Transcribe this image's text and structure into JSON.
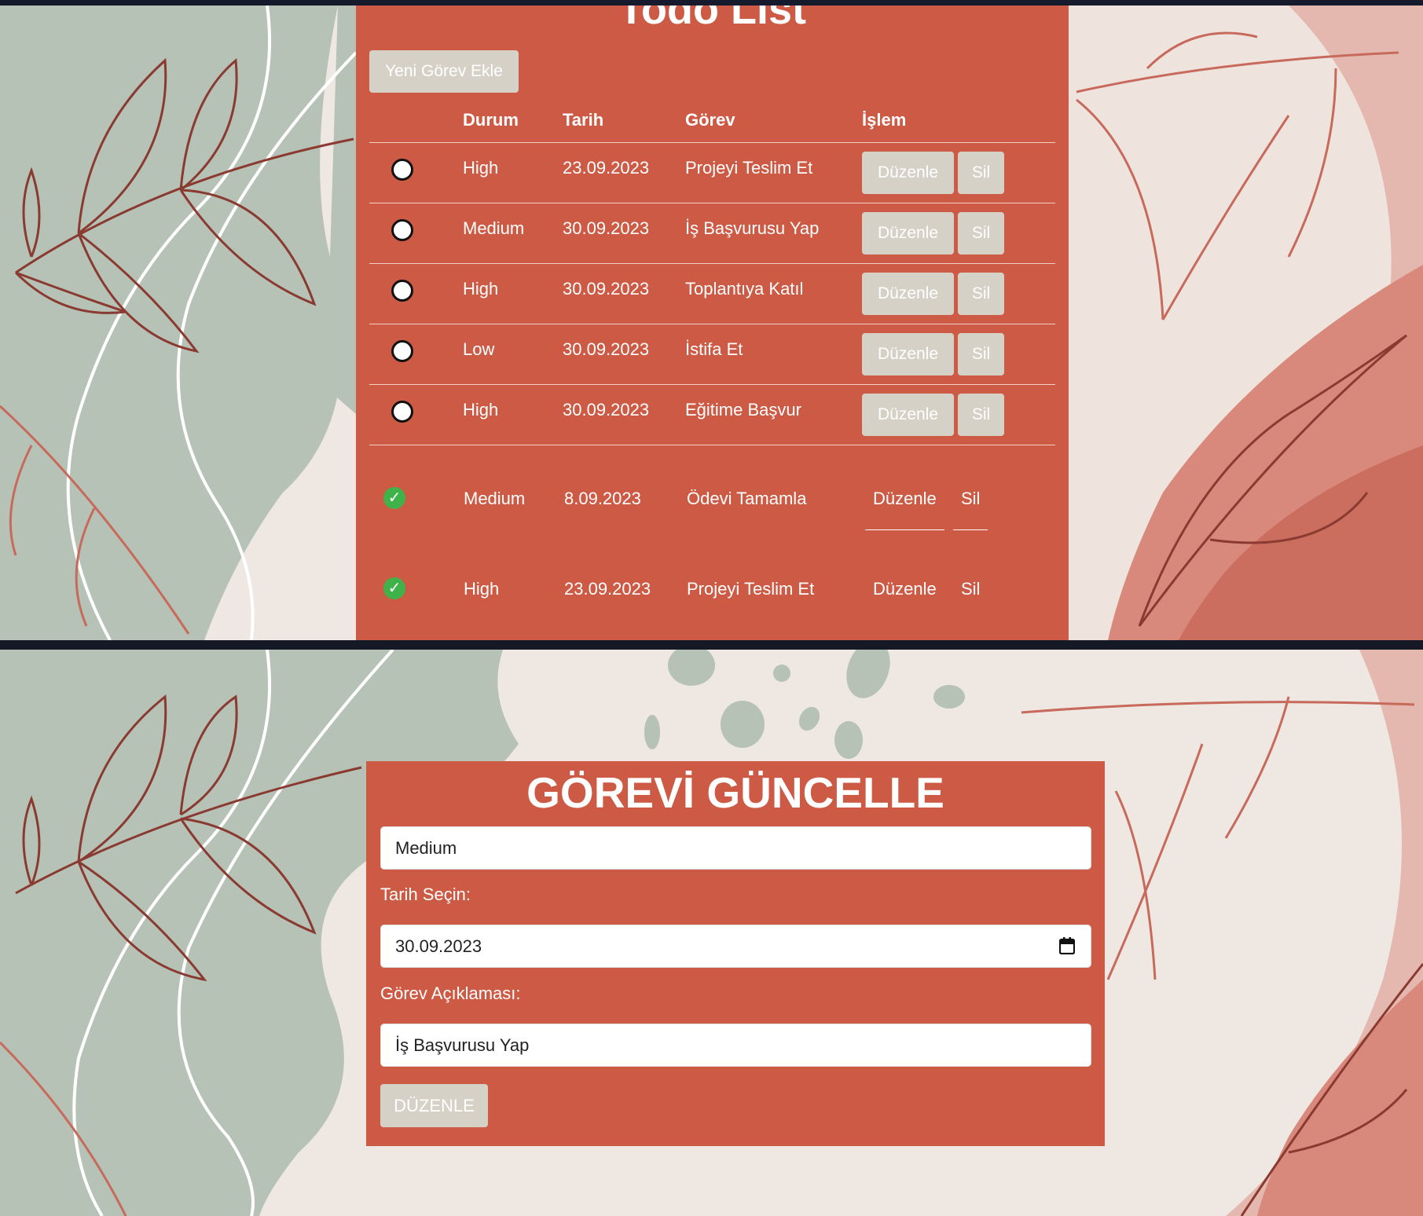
{
  "todo": {
    "title": "Todo List",
    "add_button": "Yeni Görev Ekle",
    "headers": [
      "Durum",
      "Tarih",
      "Görev",
      "İşlem"
    ],
    "edit_label": "Düzenle",
    "delete_label": "Sil",
    "rows": [
      {
        "priority": "High",
        "date": "23.09.2023",
        "task": "Projeyi Teslim Et"
      },
      {
        "priority": "Medium",
        "date": "30.09.2023",
        "task": "İş Başvurusu Yap"
      },
      {
        "priority": "High",
        "date": "30.09.2023",
        "task": "Toplantıya Katıl"
      },
      {
        "priority": "Low",
        "date": "30.09.2023",
        "task": "İstifa Et"
      },
      {
        "priority": "High",
        "date": "30.09.2023",
        "task": "Eğitime Başvur"
      }
    ],
    "completed": [
      {
        "priority": "Medium",
        "date": "8.09.2023",
        "task": "Ödevi Tamamla"
      },
      {
        "priority": "High",
        "date": "23.09.2023",
        "task": "Projeyi Teslim Et"
      }
    ]
  },
  "form": {
    "title": "GÖREVİ GÜNCELLE",
    "priority_value": "Medium",
    "date_label": "Tarih Seçin:",
    "date_value": "30.09.2023",
    "desc_label": "Görev Açıklaması:",
    "desc_value": "İş Başvurusu Yap",
    "submit": "DÜZENLE"
  },
  "colors": {
    "panel": "#cd5a45",
    "button": "#d5d1c6",
    "sage": "#b6c2b6",
    "cream": "#efe7e2",
    "check": "#3fb34a"
  }
}
